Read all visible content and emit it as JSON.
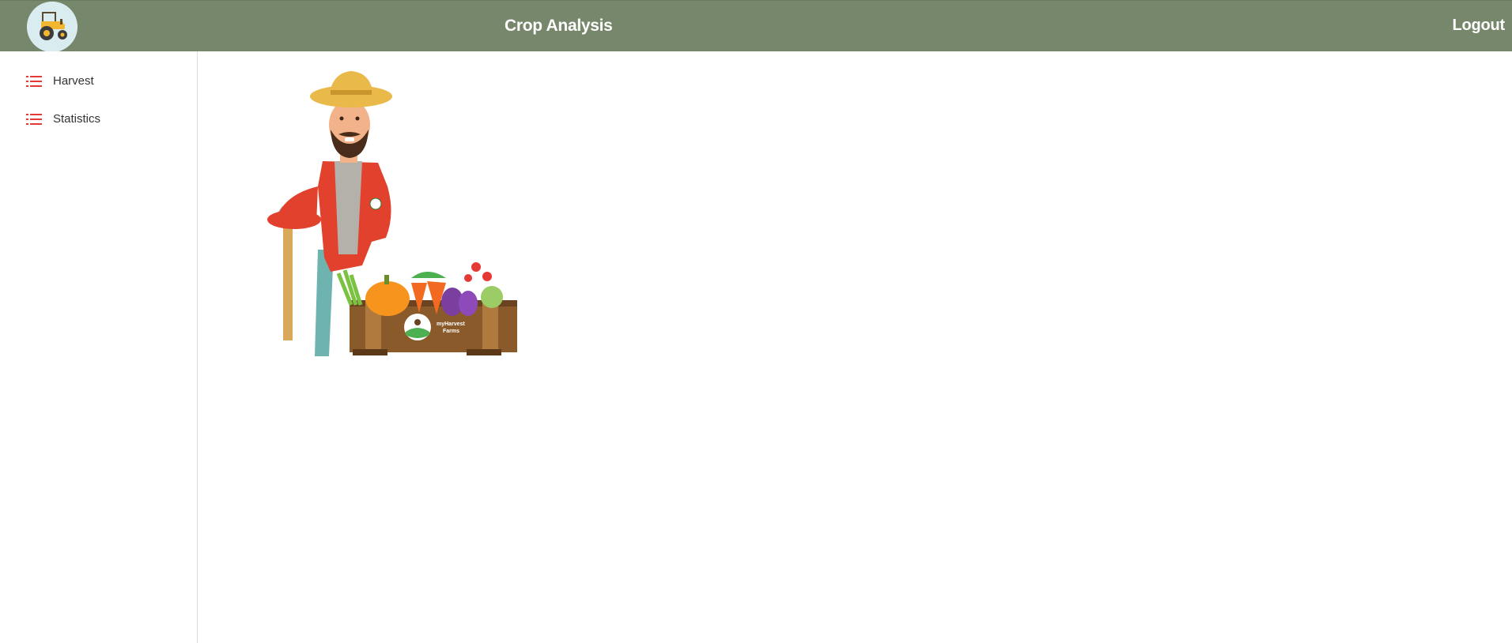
{
  "header": {
    "title": "Crop Analysis",
    "logout_label": "Logout",
    "logo_icon": "tractor-icon",
    "background": "#77876b"
  },
  "sidebar": {
    "items": [
      {
        "label": "Harvest",
        "icon": "list-icon"
      },
      {
        "label": "Statistics",
        "icon": "list-icon"
      }
    ],
    "icon_color": "#e53935"
  },
  "main": {
    "illustration": {
      "crate_text_line1": "myHarvest",
      "crate_text_line2": "Farms"
    }
  }
}
